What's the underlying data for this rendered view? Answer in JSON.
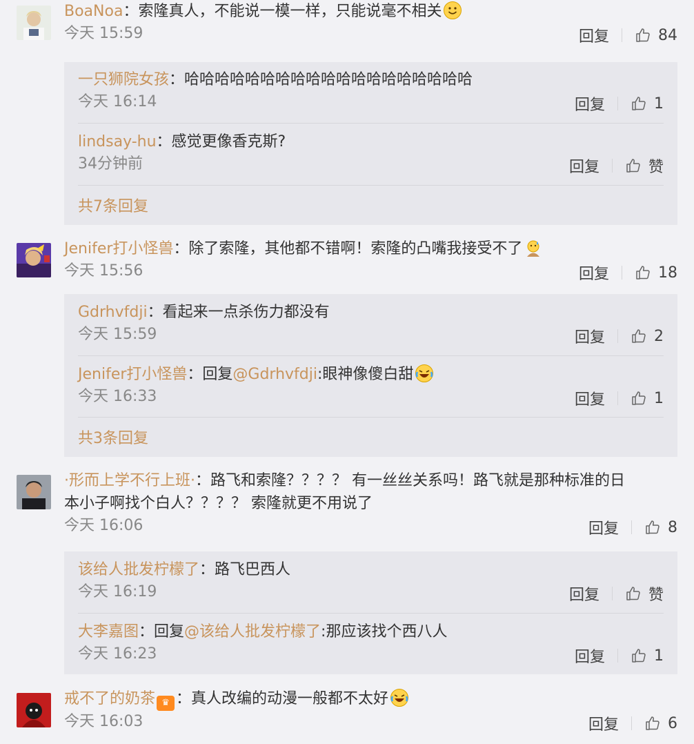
{
  "comments": [
    {
      "user": "BoaNoa",
      "text": "：索隆真人，不能说一模一样，只能说毫不相关",
      "time": "今天 15:59",
      "reply_label": "回复",
      "likes": "84",
      "replies": [
        {
          "user": "一只狮院女孩",
          "text": "：哈哈哈哈哈哈哈哈哈哈哈哈哈哈哈哈哈哈哈",
          "time": "今天 16:14",
          "reply_label": "回复",
          "likes": "1"
        },
        {
          "user": "lindsay-hu",
          "text": "：感觉更像香克斯?",
          "time": "34分钟前",
          "reply_label": "回复",
          "likes": "赞"
        }
      ],
      "more": "共7条回复"
    },
    {
      "user": "Jenifer打小怪兽",
      "text": "：除了索隆，其他都不错啊！索隆的凸嘴我接受不了",
      "time": "今天 15:56",
      "reply_label": "回复",
      "likes": "18",
      "replies": [
        {
          "user": "Gdrhvfdji",
          "text": "：看起来一点杀伤力都没有",
          "time": "今天 15:59",
          "reply_label": "回复",
          "likes": "2"
        },
        {
          "user": "Jenifer打小怪兽",
          "text_prefix": "：回复",
          "mention": "@Gdrhvfdji",
          "text": ":眼神像傻白甜",
          "time": "今天 16:33",
          "reply_label": "回复",
          "likes": "1"
        }
      ],
      "more": "共3条回复"
    },
    {
      "user": "·形而上学不行上班·",
      "text": "：路飞和索隆？？？？ 有一丝丝关系吗！路飞就是那种标准的日",
      "text2": "本小子啊找个白人？？？？ 索隆就更不用说了",
      "time": "今天 16:06",
      "reply_label": "回复",
      "likes": "8",
      "replies": [
        {
          "user": "该给人批发柠檬了",
          "text": "：路飞巴西人",
          "time": "今天 16:19",
          "reply_label": "回复",
          "likes": "赞"
        },
        {
          "user": "大李嘉图",
          "text_prefix": "：回复",
          "mention": "@该给人批发柠檬了",
          "text": ":那应该找个西八人",
          "time": "今天 16:23",
          "reply_label": "回复",
          "likes": "1"
        }
      ]
    },
    {
      "user": "戒不了的奶茶",
      "text": "：真人改编的动漫一般都不太好",
      "time": "今天 16:03",
      "reply_label": "回复",
      "likes": "6",
      "replies": []
    }
  ],
  "colors": {
    "username": "#c8945c",
    "bg": "#f2f2f5",
    "reply_bg": "#e7e7ec"
  },
  "icons": [
    "thumbs-up-icon",
    "smile-emoji",
    "laugh-cry-emoji",
    "sweat-emoji",
    "vip-badge-icon"
  ]
}
